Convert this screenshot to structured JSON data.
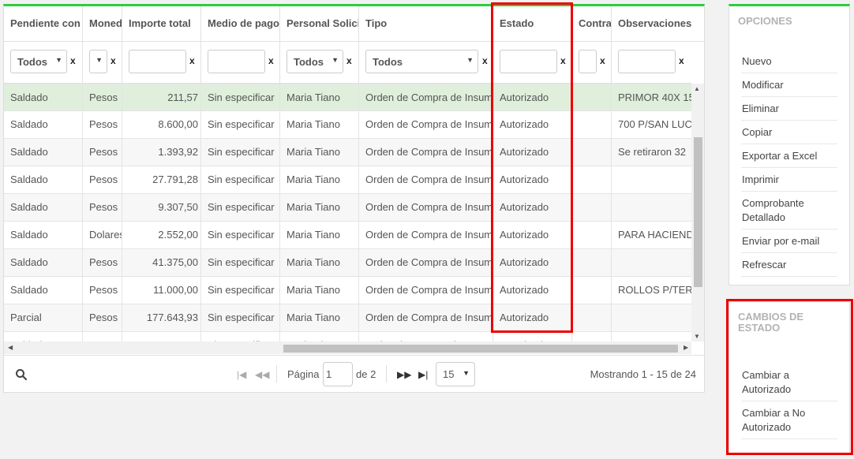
{
  "grid": {
    "columns": [
      "Pendiente con",
      "Moneda",
      "Importe total",
      "Medio de pago",
      "Personal Solicitante",
      "Tipo",
      "Estado",
      "Contrato",
      "Observaciones"
    ],
    "filters": {
      "pendiente": "Todos",
      "moneda": "",
      "personal": "Todos",
      "tipo": "Todos",
      "clear": "x"
    },
    "rows": [
      {
        "pendiente": "Saldado",
        "moneda": "Pesos",
        "importe": "211,57",
        "medio": "Sin especificar",
        "personal": "Maria Tiano",
        "tipo": "Orden de Compra de Insumos",
        "estado": "Autorizado",
        "contrato": "",
        "obs": "PRIMOR 40X 15"
      },
      {
        "pendiente": "Saldado",
        "moneda": "Pesos",
        "importe": "8.600,00",
        "medio": "Sin especificar",
        "personal": "Maria Tiano",
        "tipo": "Orden de Compra de Insumos",
        "estado": "Autorizado",
        "contrato": "",
        "obs": "700 P/SAN LUC"
      },
      {
        "pendiente": "Saldado",
        "moneda": "Pesos",
        "importe": "1.393,92",
        "medio": "Sin especificar",
        "personal": "Maria Tiano",
        "tipo": "Orden de Compra de Insumos",
        "estado": "Autorizado",
        "contrato": "",
        "obs": "Se retiraron 32"
      },
      {
        "pendiente": "Saldado",
        "moneda": "Pesos",
        "importe": "27.791,28",
        "medio": "Sin especificar",
        "personal": "Maria Tiano",
        "tipo": "Orden de Compra de Insumos",
        "estado": "Autorizado",
        "contrato": "",
        "obs": ""
      },
      {
        "pendiente": "Saldado",
        "moneda": "Pesos",
        "importe": "9.307,50",
        "medio": "Sin especificar",
        "personal": "Maria Tiano",
        "tipo": "Orden de Compra de Insumos",
        "estado": "Autorizado",
        "contrato": "",
        "obs": ""
      },
      {
        "pendiente": "Saldado",
        "moneda": "Dolares",
        "importe": "2.552,00",
        "medio": "Sin especificar",
        "personal": "Maria Tiano",
        "tipo": "Orden de Compra de Insumos",
        "estado": "Autorizado",
        "contrato": "",
        "obs": "PARA HACIEND"
      },
      {
        "pendiente": "Saldado",
        "moneda": "Pesos",
        "importe": "41.375,00",
        "medio": "Sin especificar",
        "personal": "Maria Tiano",
        "tipo": "Orden de Compra de Insumos",
        "estado": "Autorizado",
        "contrato": "",
        "obs": ""
      },
      {
        "pendiente": "Saldado",
        "moneda": "Pesos",
        "importe": "11.000,00",
        "medio": "Sin especificar",
        "personal": "Maria Tiano",
        "tipo": "Orden de Compra de Insumos",
        "estado": "Autorizado",
        "contrato": "",
        "obs": "ROLLOS P/TERM"
      },
      {
        "pendiente": "Parcial",
        "moneda": "Pesos",
        "importe": "177.643,93",
        "medio": "Sin especificar",
        "personal": "Maria Tiano",
        "tipo": "Orden de Compra de Insumos",
        "estado": "Autorizado",
        "contrato": "",
        "obs": ""
      },
      {
        "pendiente": "Saldado",
        "moneda": "Pesos",
        "importe": "",
        "medio": "Sin especificar",
        "personal": "Maria Tiano",
        "tipo": "Orden de Compra de Insumos",
        "estado": "Autorizado",
        "contrato": "",
        "obs": ""
      }
    ],
    "pager": {
      "page_label": "Página",
      "page_value": "1",
      "of_label": "de 2",
      "page_size": "15",
      "info": "Mostrando 1 - 15 de 24"
    }
  },
  "opciones": {
    "title": "OPCIONES",
    "items": [
      "Nuevo",
      "Modificar",
      "Eliminar",
      "Copiar",
      "Exportar a Excel",
      "Imprimir",
      "Comprobante Detallado",
      "Enviar por e-mail",
      "Refrescar"
    ]
  },
  "cambios": {
    "title": "CAMBIOS DE ESTADO",
    "items": [
      "Cambiar a Autorizado",
      "Cambiar a No Autorizado"
    ]
  },
  "colors": {
    "accent": "#2ecc40",
    "selected_row": "#dfefdc",
    "highlight": "#e00000"
  }
}
